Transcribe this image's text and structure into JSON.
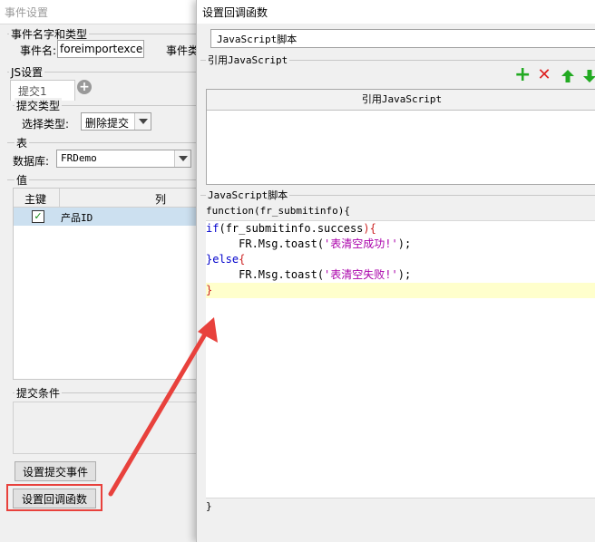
{
  "left_dialog": {
    "window_title": "事件设置",
    "event_group_label": "事件名字和类型",
    "event_name_label": "事件名:",
    "event_name_value": "foreimportexcel",
    "event_type_label_partial": "事件类",
    "js_settings_label": "JS设置",
    "tab_label": "提交1",
    "submit_type_group": "提交类型",
    "select_type_label": "选择类型:",
    "select_type_value": "删除提交",
    "table_group": "表",
    "database_label": "数据库:",
    "database_value": "FRDemo",
    "value_group": "值",
    "columns": {
      "primary_key": "主键",
      "column": "列"
    },
    "rows": [
      {
        "checked": true,
        "column": "产品ID"
      }
    ],
    "submit_condition_group": "提交条件",
    "set_submit_event_button": "设置提交事件",
    "set_callback_button": "设置回调函数"
  },
  "right_dialog": {
    "window_title": "设置回调函数",
    "script_type_value": "JavaScript脚本",
    "ref_group_label": "引用JavaScript",
    "ref_table_header": "引用JavaScript",
    "script_group_label": "JavaScript脚本",
    "function_header": "function(fr_submitinfo){",
    "closing_brace": "}",
    "code_lines": [
      {
        "kw1": "if",
        "pre": "(",
        "body": "fr_submitinfo.success",
        "post": "){",
        "str": ""
      },
      {
        "indent": "     ",
        "body": "FR.Msg.toast(",
        "str": "'表清空成功!'",
        "post": ");"
      },
      {
        "kw1": "}else",
        "post": "{"
      },
      {
        "indent": "     ",
        "body": "FR.Msg.toast(",
        "str": "'表清空失败!'",
        "post": ");"
      },
      {
        "brace": "}"
      }
    ]
  },
  "colors": {
    "highlight_line": "#ffffcc",
    "selected_row": "#cce0f0",
    "annotation": "#e8413c",
    "toolbar_green": "#22aa22",
    "toolbar_red": "#dd2222"
  }
}
